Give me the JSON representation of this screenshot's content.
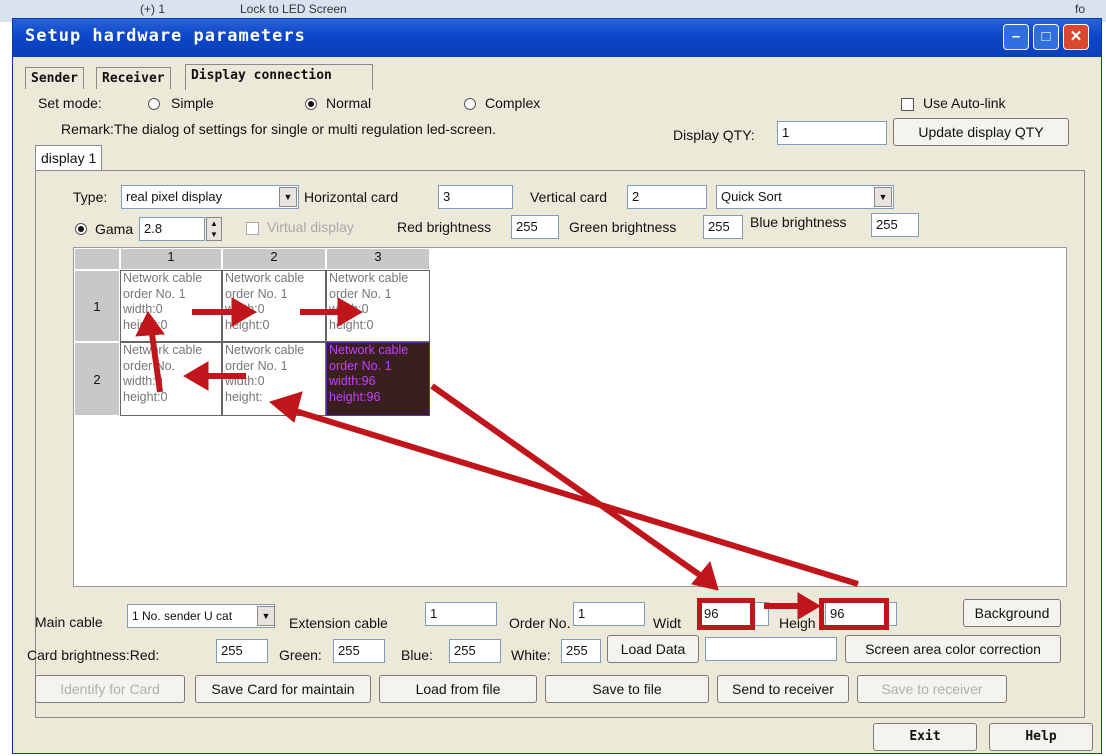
{
  "background_fragments": [
    "(+)  1",
    "Lock to LED Screen",
    "fo"
  ],
  "window": {
    "title": "Setup hardware parameters"
  },
  "tabs": [
    "Sender",
    "Receiver",
    "Display connection"
  ],
  "set_mode": {
    "label": "Set mode:",
    "options": [
      "Simple",
      "Normal",
      "Complex"
    ],
    "selected": "Normal"
  },
  "auto_link": {
    "label": "Use Auto-link",
    "checked": false
  },
  "remark": "Remark:The dialog of settings for single or multi  regulation led-screen.",
  "display_qty": {
    "label": "Display QTY:",
    "value": "1",
    "update_button": "Update display QTY"
  },
  "display_tab": "display 1",
  "type": {
    "label": "Type:",
    "value": "real pixel display"
  },
  "horizontal_card": {
    "label": "Horizontal card",
    "value": "3"
  },
  "vertical_card": {
    "label": "Vertical card",
    "value": "2"
  },
  "sort": {
    "value": "Quick Sort"
  },
  "gama": {
    "label": "Gama",
    "value": "2.8"
  },
  "virtual_display": {
    "label": "Virtual display",
    "checked": false
  },
  "red_brightness": {
    "label": "Red brightness",
    "value": "255"
  },
  "green_brightness": {
    "label": "Green brightness",
    "value": "255"
  },
  "blue_brightness": {
    "label": "Blue brightness",
    "value": "255"
  },
  "grid": {
    "col_headers": [
      "1",
      "2",
      "3"
    ],
    "row_headers": [
      "1",
      "2"
    ],
    "cells": [
      [
        [
          "Network cable",
          "order No. 1",
          "width:0",
          "height:0"
        ],
        [
          "Network cable",
          "order No. 1",
          "width:0",
          "height:0"
        ],
        [
          "Network cable",
          "order No. 1",
          "width:0",
          "height:0"
        ]
      ],
      [
        [
          "Network cable",
          "order No.",
          "width:0",
          "height:0"
        ],
        [
          "Network cable",
          "order No. 1",
          "width:0",
          "height:"
        ],
        [
          "Network cable",
          "order No. 1",
          "width:96",
          "height:96"
        ]
      ]
    ]
  },
  "main_cable": {
    "label": "Main cable",
    "value": "1 No. sender U cat"
  },
  "extension_cable": {
    "label": "Extension cable",
    "value": "1"
  },
  "order_no": {
    "label": "Order No.",
    "value": "1"
  },
  "width": {
    "label": "Widt",
    "value": "96"
  },
  "height": {
    "label": "Heigh",
    "value": "96"
  },
  "background_button": "Background",
  "card_brightness": {
    "red_label": "Card brightness:Red:",
    "red": "255",
    "green_label": "Green:",
    "green": "255",
    "blue_label": "Blue:",
    "blue": "255",
    "white_label": "White:",
    "white": "255"
  },
  "load_data_button": "Load Data",
  "load_data_value": "",
  "screen_area_button": "Screen area color correction",
  "actions": [
    "Identify for Card",
    "Save Card for maintain",
    "Load from file",
    "Save to file",
    "Send to receiver",
    "Save to receiver"
  ],
  "footer": {
    "exit": "Exit",
    "help": "Help"
  },
  "annotation_color": "#c0151b"
}
